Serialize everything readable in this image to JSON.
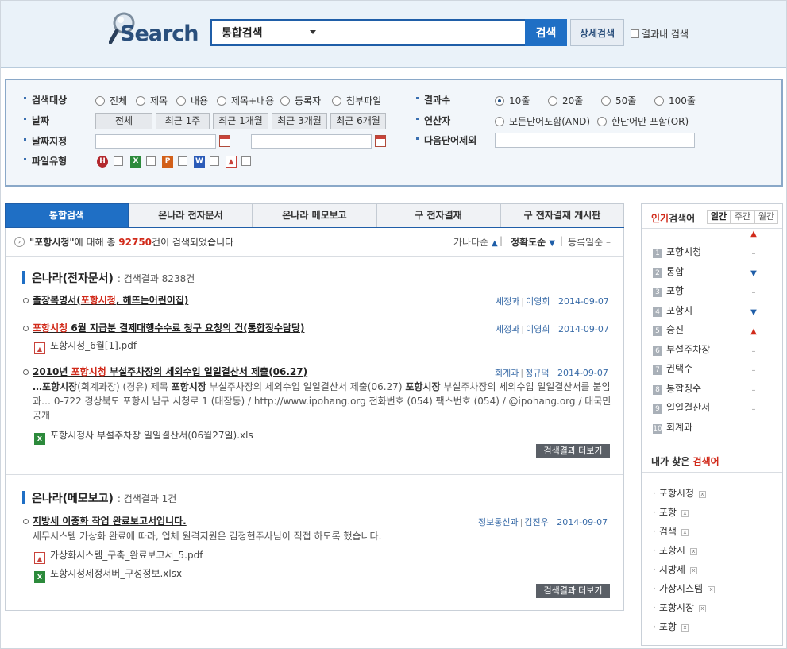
{
  "header": {
    "logo_text": "Search",
    "search_scope": "통합검색",
    "search_value": "",
    "search_button": "검색",
    "advanced_button": "상세검색",
    "within_results": "결과내 검색"
  },
  "options": {
    "target_label": "검색대상",
    "target_options": [
      "전체",
      "제목",
      "내용",
      "제목+내용",
      "등록자",
      "첨부파일"
    ],
    "date_label": "날짜",
    "date_buttons": [
      "전체",
      "최근 1주",
      "최근 1개월",
      "최근 3개월",
      "최근 6개월"
    ],
    "date_range_label": "날짜지정",
    "date_range_sep": "-",
    "filetype_label": "파일유형",
    "file_types": [
      "hwp",
      "xls",
      "ppt",
      "doc",
      "pdf"
    ],
    "count_label": "결과수",
    "count_options": [
      "10줄",
      "20줄",
      "50줄",
      "100줄"
    ],
    "count_selected": "10줄",
    "operator_label": "연산자",
    "operator_options": [
      "모든단어포함(AND)",
      "한단어만 포함(OR)"
    ],
    "operator_selected": "모든단어포함(AND)",
    "exclude_label": "다음단어제외"
  },
  "tabs": [
    "통합검색",
    "온나라 전자문서",
    "온나라 메모보고",
    "구 전자결재",
    "구 전자결재 게시판"
  ],
  "summary": {
    "query": "\"포항시청\"",
    "mid1": "에 대해 총 ",
    "count": "92750",
    "mid2": "건이 검색되었습니다",
    "sort": [
      "가나다순",
      "정확도순",
      "등록일순"
    ]
  },
  "sections": [
    {
      "title": "온나라(전자문서)",
      "subtitle": ": 검색결과 8238건",
      "docs": [
        {
          "title_pre": "출장복명서(",
          "title_hl": "포항시청",
          "title_post": ", 해뜨는어린이집)",
          "dept": "세정과",
          "author": "이영희",
          "date": "2014-09-07"
        },
        {
          "title_pre": "",
          "title_hl": "포항시청",
          "title_post": " 6월 지급분 결제대행수수료 청구 요청의 건(통합징수담당)",
          "dept": "세정과",
          "author": "이영희",
          "date": "2014-09-07",
          "attachment": "포항시청_6월[1].pdf"
        },
        {
          "title_pre": "2010년 ",
          "title_hl": "포항시청",
          "title_post": " 부설주차장의 세외수입 일일결산서 제출(06.27)",
          "dept": "회계과",
          "author": "정규덕",
          "date": "2014-09-07",
          "snippet_1": "…포항시장",
          "snippet_2": "(회계과장) (경유) 제목 ",
          "snippet_3": "포항시장",
          "snippet_4": " 부설주차장의 세외수입 일일결산서 제출(06.27) ",
          "snippet_5": "포항시장",
          "snippet_6": " 부설주차장의 세외수입 일일결산서를 붙임과… 0-722 경상북도 포항시 남구 시청로 1 (대잠동) / http://www.ipohang.org 전화번호 (054) 팩스번호 (054) / @ipohang.org / 대국민 공개",
          "attachment": "포항시청사 부설주차장 일일결산서(06월27일).xls"
        }
      ],
      "more": "검색결과 더보기"
    },
    {
      "title": "온나라(메모보고)",
      "subtitle": ": 검색결과 1건",
      "docs": [
        {
          "title": "지방세 이중화 작업 완료보고서입니다.",
          "dept": "정보통신과",
          "author": "김진우",
          "date": "2014-09-07",
          "snippet": "세무시스템 가상화 완료에 따라, 업체 원격지원은 김정현주사님이 직접 하도록 했습니다.",
          "attachments": [
            "가상화시스템_구축_완료보고서_5.pdf",
            "포항시청세정서버_구성정보.xlsx"
          ]
        }
      ],
      "more": "검색결과 더보기"
    }
  ],
  "popular": {
    "title_red": "인기",
    "title_rest": "검색어",
    "periods": [
      "일간",
      "주간",
      "월간"
    ],
    "active_period": "일간",
    "items": [
      {
        "rank": "1",
        "word": "포항시청",
        "trend": "up"
      },
      {
        "rank": "2",
        "word": "통합",
        "trend": "down"
      },
      {
        "rank": "3",
        "word": "포항",
        "trend": "same"
      },
      {
        "rank": "4",
        "word": "포항시",
        "trend": "down"
      },
      {
        "rank": "5",
        "word": "승진",
        "trend": "up"
      },
      {
        "rank": "6",
        "word": "부설주차장",
        "trend": "same"
      },
      {
        "rank": "7",
        "word": "권택수",
        "trend": "same"
      },
      {
        "rank": "8",
        "word": "통합징수",
        "trend": "same"
      },
      {
        "rank": "9",
        "word": "일일결산서",
        "trend": "same"
      },
      {
        "rank": "10",
        "word": "회계과",
        "trend": ""
      }
    ],
    "my_title_pre": "내가 찾은 ",
    "my_title_red": "검색어",
    "my_items": [
      "포항시청",
      "포항",
      "검색",
      "포항시",
      "지방세",
      "가상시스템",
      "포항시장",
      "포항"
    ]
  }
}
